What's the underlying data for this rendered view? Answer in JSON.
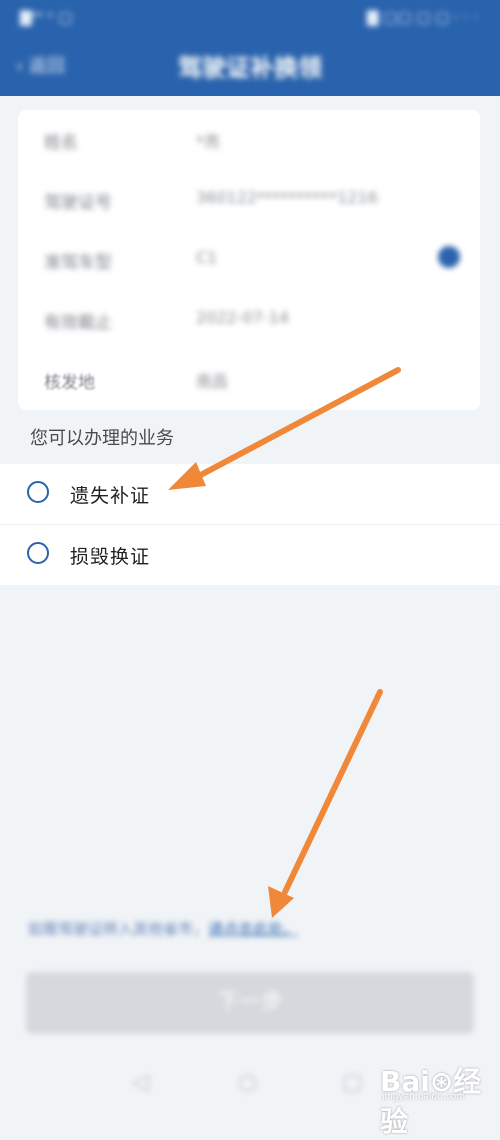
{
  "header": {
    "status_left": "▇ᵃⁱˡ ᵒ ▢",
    "status_right": "▇ ▢▢ ▢ ▢ · · ·",
    "back_label": "‹ 返回",
    "title": "驾驶证补换领"
  },
  "info": {
    "rows": [
      {
        "label": "姓名",
        "value": "*亮"
      },
      {
        "label": "驾驶证号",
        "value": "360122**********1216"
      },
      {
        "label": "准驾车型",
        "value": "C1"
      },
      {
        "label": "有效截止",
        "value": "2022-07-14"
      },
      {
        "label": "核发地",
        "value": "南昌"
      }
    ]
  },
  "section_title": "您可以办理的业务",
  "options": [
    {
      "label": "遗失补证"
    },
    {
      "label": "损毁换证"
    }
  ],
  "notice": {
    "text": "如需驾驶证转入其他省市，",
    "link": "请点击此处。"
  },
  "submit": {
    "label": "下一步"
  },
  "bottom_nav": {
    "back": "◁",
    "home": "○",
    "recent": "▢"
  },
  "watermark": {
    "logo": "Bai⊛经验",
    "url": "jingyan.baidu.com"
  },
  "colors": {
    "brand": "#2a63ad",
    "arrow": "#f0883a"
  }
}
